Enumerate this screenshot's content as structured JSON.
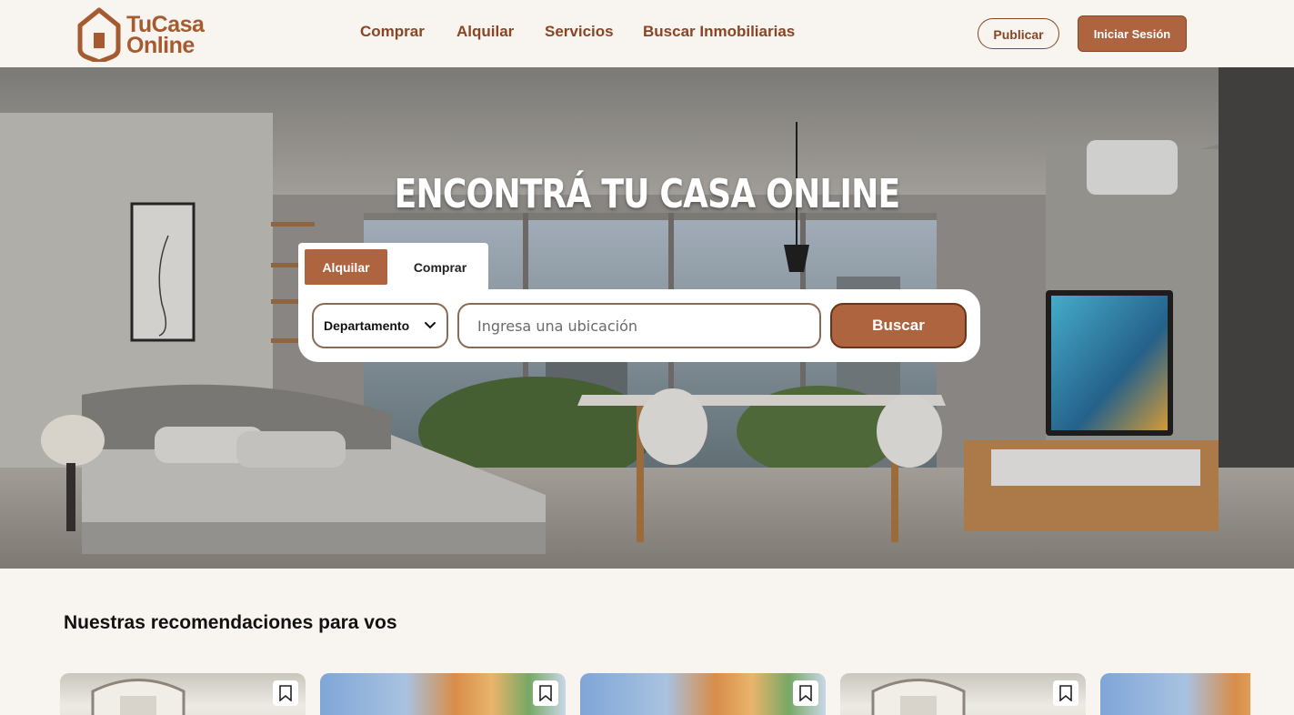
{
  "header": {
    "logo_line1": "TuCasa",
    "logo_line2": "Online",
    "nav": [
      "Comprar",
      "Alquilar",
      "Servicios",
      "Buscar Inmobiliarias"
    ],
    "publish_label": "Publicar",
    "login_label": "Iniciar Sesión",
    "brand_color": "#ad643f",
    "text_color": "#8a4524"
  },
  "hero": {
    "title": "ENCONTRÁ TU CASA ONLINE",
    "tabs": [
      "Alquilar",
      "Comprar"
    ],
    "active_tab": "Alquilar",
    "property_type": "Departamento",
    "location_placeholder": "Ingresa una ubicación",
    "search_label": "Buscar"
  },
  "recommendations": {
    "title": "Nuestras recomendaciones para vos",
    "cards": [
      {
        "image": "house-facade",
        "bookmark_icon": "bookmark-icon"
      },
      {
        "image": "building-palms",
        "bookmark_icon": "bookmark-icon"
      },
      {
        "image": "building-palms",
        "bookmark_icon": "bookmark-icon"
      },
      {
        "image": "house-facade",
        "bookmark_icon": "bookmark-icon"
      },
      {
        "image": "building-palms",
        "bookmark_icon": "bookmark-icon"
      }
    ]
  }
}
